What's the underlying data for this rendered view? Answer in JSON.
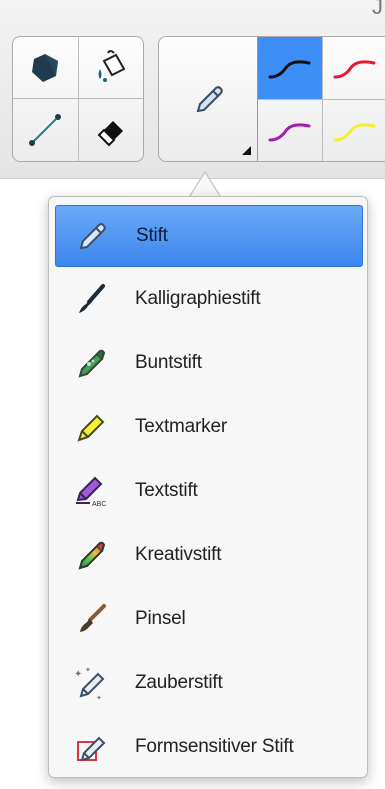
{
  "toolbar": {
    "corner_glyph": "J",
    "tools": [
      {
        "name": "polygon-tool",
        "icon": "polygon-icon"
      },
      {
        "name": "fill-tool",
        "icon": "paint-bucket-icon"
      },
      {
        "name": "line-tool",
        "icon": "line-icon"
      },
      {
        "name": "eraser-tool",
        "icon": "eraser-icon"
      }
    ],
    "pen_button": {
      "icon": "pencil-icon"
    },
    "colors": [
      {
        "name": "black",
        "hex": "#111111",
        "selected": true
      },
      {
        "name": "red",
        "hex": "#e8192c",
        "selected": false
      },
      {
        "name": "purple",
        "hex": "#a21caf",
        "selected": false
      },
      {
        "name": "yellow",
        "hex": "#f3f033",
        "selected": false
      }
    ]
  },
  "pen_menu": {
    "selected_index": 0,
    "items": [
      {
        "label": "Stift",
        "icon": "pen-icon"
      },
      {
        "label": "Kalligraphiestift",
        "icon": "calligraphy-pen-icon"
      },
      {
        "label": "Buntstift",
        "icon": "crayon-icon"
      },
      {
        "label": "Textmarker",
        "icon": "highlighter-icon"
      },
      {
        "label": "Textstift",
        "icon": "text-pen-icon"
      },
      {
        "label": "Kreativstift",
        "icon": "creative-pen-icon"
      },
      {
        "label": "Pinsel",
        "icon": "brush-icon"
      },
      {
        "label": "Zauberstift",
        "icon": "magic-pen-icon"
      },
      {
        "label": "Formsensitiver Stift",
        "icon": "shape-recognition-pen-icon"
      }
    ]
  }
}
